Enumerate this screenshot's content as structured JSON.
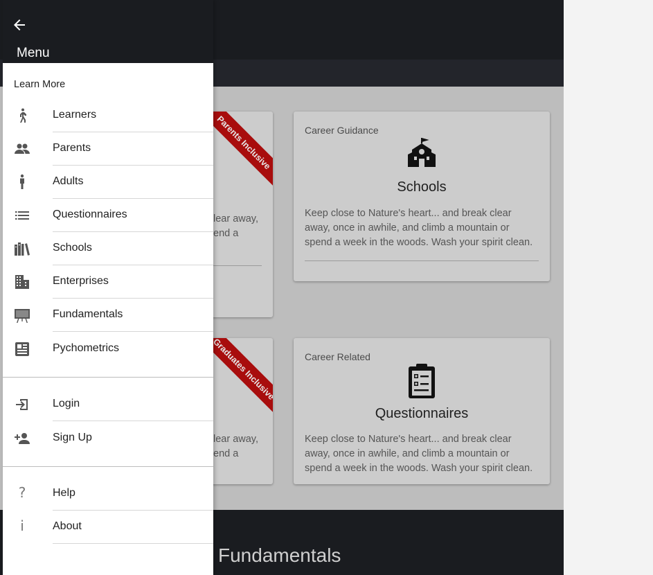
{
  "drawer": {
    "title": "Menu",
    "section_label": "Learn More",
    "items": [
      {
        "label": "Learners",
        "icon": "walking-person-icon"
      },
      {
        "label": "Parents",
        "icon": "people-icon"
      },
      {
        "label": "Adults",
        "icon": "person-icon"
      },
      {
        "label": "Questionnaires",
        "icon": "list-icon"
      },
      {
        "label": "Schools",
        "icon": "books-icon"
      },
      {
        "label": "Enterprises",
        "icon": "building-icon"
      },
      {
        "label": "Fundamentals",
        "icon": "presentation-board-icon"
      },
      {
        "label": "Pychometrics",
        "icon": "article-icon"
      }
    ],
    "auth_items": [
      {
        "label": "Login",
        "icon": "login-icon"
      },
      {
        "label": "Sign Up",
        "icon": "add-person-icon"
      }
    ],
    "info_items": [
      {
        "label": "Help",
        "icon": "question-icon",
        "glyph": "?"
      },
      {
        "label": "About",
        "icon": "info-icon",
        "glyph": "i"
      }
    ]
  },
  "cards": {
    "schools": {
      "eyebrow": "Career Guidance",
      "title": "Schools",
      "text": "Keep close to Nature's heart... and break clear away, once in awhile, and climb a mountain or spend a week in the woods. Wash your spirit clean."
    },
    "questionnaires": {
      "eyebrow": "Career Related",
      "title": "Questionnaires",
      "text": "Keep close to Nature's heart... and break clear away, once in awhile, and climb a mountain or spend a week in the woods. Wash your spirit clean."
    },
    "left_top": {
      "ribbon": "Parents Inclusive",
      "fragment_1": "lear away,",
      "fragment_2": "end a"
    },
    "left_bottom": {
      "ribbon": "Graduates Inclusive",
      "fragment_1": "lear away,",
      "fragment_2": "end a"
    }
  },
  "footer": {
    "title": "Fundamentals"
  },
  "colors": {
    "header_dark": "#1a1c20",
    "ribbon_red": "#a80d0d",
    "card_bg": "#cccccc",
    "overlay_bg": "#bdbdbd"
  }
}
